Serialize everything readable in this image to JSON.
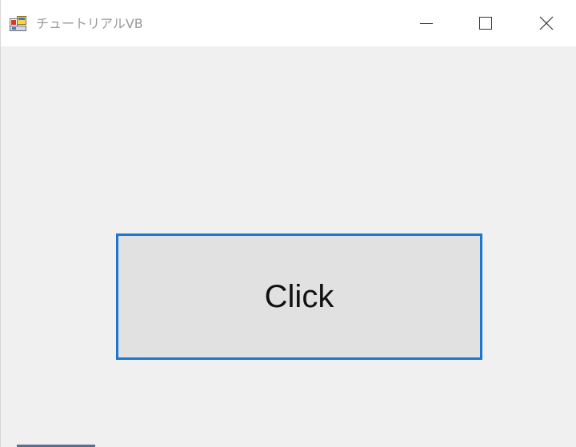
{
  "window": {
    "title": "チュートリアルVB",
    "app_icon": "winforms-app-icon",
    "controls": {
      "minimize_icon": "minimize-icon",
      "maximize_icon": "maximize-icon",
      "close_icon": "close-icon"
    }
  },
  "form": {
    "button_label": "Click"
  },
  "colors": {
    "titlebar_bg": "#ffffff",
    "form_bg": "#f0f0f0",
    "button_bg": "#e1e1e1",
    "button_focus_border": "#1977d0",
    "title_text": "#9a9a9a"
  }
}
